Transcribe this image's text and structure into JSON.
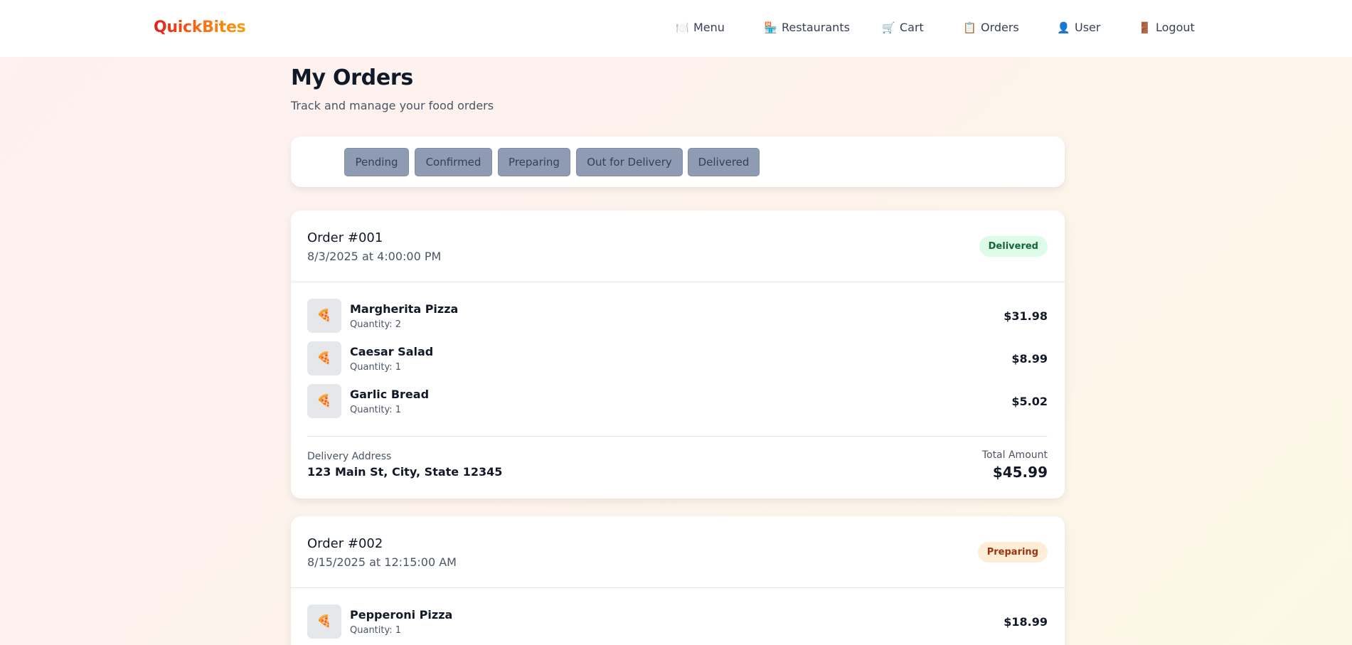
{
  "app": {
    "logo": "QuickBites"
  },
  "nav": [
    {
      "icon": "🍽️",
      "icon_name": "menu-plate-icon",
      "label": "Menu"
    },
    {
      "icon": "🏪",
      "icon_name": "restaurant-store-icon",
      "label": "Restaurants"
    },
    {
      "icon": "🛒",
      "icon_name": "cart-icon",
      "label": "Cart"
    },
    {
      "icon": "📋",
      "icon_name": "clipboard-orders-icon",
      "label": "Orders"
    },
    {
      "icon": "👤",
      "icon_name": "user-icon",
      "label": "User"
    },
    {
      "icon": "🚪",
      "icon_name": "logout-door-icon",
      "label": "Logout"
    }
  ],
  "page": {
    "title": "My Orders",
    "subtitle": "Track and manage your food orders"
  },
  "filters": [
    "Pending",
    "Confirmed",
    "Preparing",
    "Out for Delivery",
    "Delivered"
  ],
  "orders": [
    {
      "id": "Order #001",
      "date": "8/3/2025 at 4:00:00 PM",
      "status": "Delivered",
      "items": [
        {
          "icon": "🍕",
          "name": "Margherita Pizza",
          "quantity": "Quantity: 2",
          "price": "$31.98"
        },
        {
          "icon": "🍕",
          "name": "Caesar Salad",
          "quantity": "Quantity: 1",
          "price": "$8.99"
        },
        {
          "icon": "🍕",
          "name": "Garlic Bread",
          "quantity": "Quantity: 1",
          "price": "$5.02"
        }
      ],
      "address_label": "Delivery Address",
      "address": "123 Main St, City, State 12345",
      "total_label": "Total Amount",
      "total": "$45.99"
    },
    {
      "id": "Order #002",
      "date": "8/15/2025 at 12:15:00 AM",
      "status": "Preparing",
      "items": [
        {
          "icon": "🍕",
          "name": "Pepperoni Pizza",
          "quantity": "Quantity: 1",
          "price": "$18.99"
        }
      ]
    }
  ],
  "colors": {
    "badge_delivered_bg": "#dcfce7",
    "badge_delivered_text": "#166534",
    "badge_preparing_bg": "#ffedd5",
    "badge_preparing_text": "#9a3412",
    "filter_button_bg": "#8e9bb2"
  }
}
